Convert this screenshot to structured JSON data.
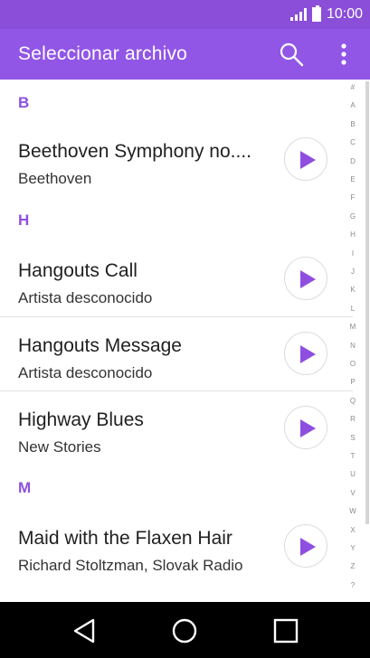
{
  "status_bar": {
    "time": "10:00"
  },
  "app_bar": {
    "title": "Seleccionar archivo"
  },
  "sections": [
    {
      "letter": "B"
    },
    {
      "letter": "H"
    },
    {
      "letter": "M"
    }
  ],
  "tracks": [
    {
      "title": "Beethoven Symphony no....",
      "artist": "Beethoven"
    },
    {
      "title": "Hangouts Call",
      "artist": "Artista desconocido"
    },
    {
      "title": "Hangouts Message",
      "artist": "Artista desconocido"
    },
    {
      "title": "Highway Blues",
      "artist": "New Stories"
    },
    {
      "title": "Maid with the Flaxen Hair",
      "artist": "Richard Stoltzman, Slovak Radio"
    }
  ],
  "index_letters": [
    "#",
    "A",
    "B",
    "C",
    "D",
    "E",
    "F",
    "G",
    "H",
    "I",
    "J",
    "K",
    "L",
    "M",
    "N",
    "O",
    "P",
    "Q",
    "R",
    "S",
    "T",
    "U",
    "V",
    "W",
    "X",
    "Y",
    "Z",
    "?"
  ],
  "colors": {
    "accent": "#9156e6",
    "status_bar": "#8a4ed8",
    "play": "#8e4fe0"
  },
  "icons": [
    "search-icon",
    "more-vert-icon",
    "play-icon",
    "back-icon",
    "home-icon",
    "recent-apps-icon"
  ]
}
